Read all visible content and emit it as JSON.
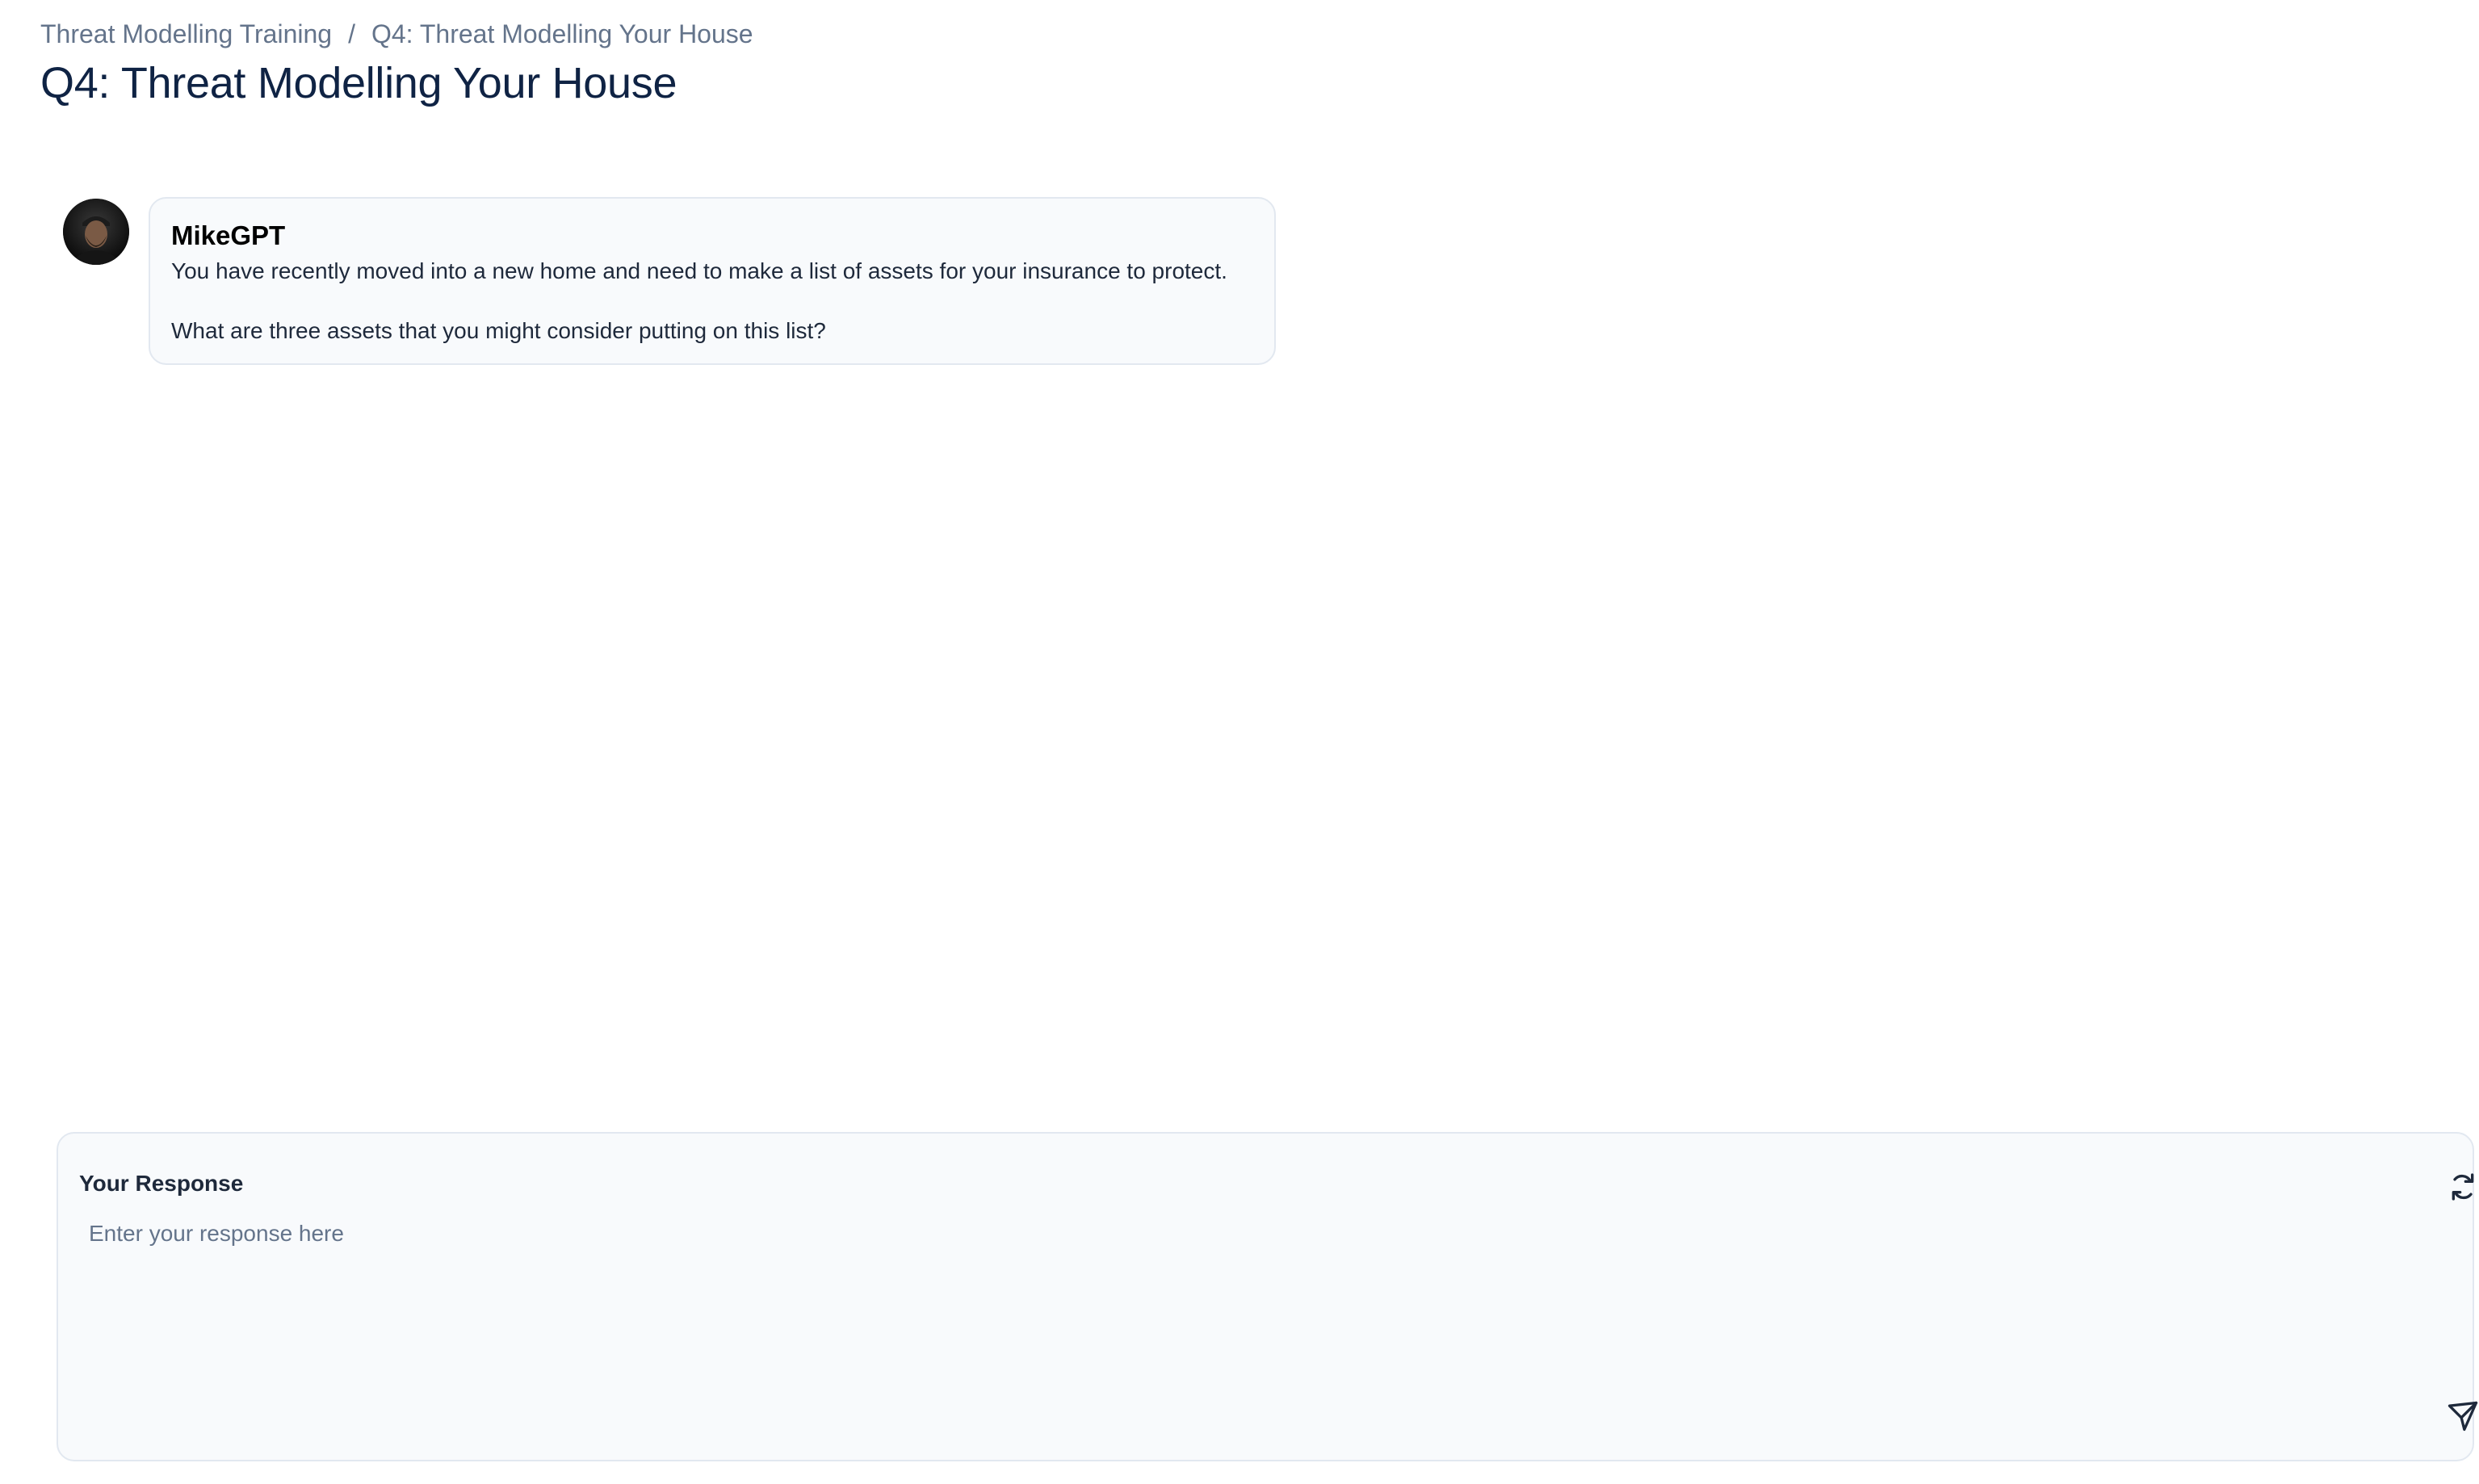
{
  "breadcrumb": {
    "parent": "Threat Modelling Training",
    "separator": "/",
    "current": "Q4: Threat Modelling Your House"
  },
  "page": {
    "title": "Q4: Threat Modelling Your House"
  },
  "message": {
    "sender": "MikeGPT",
    "avatar_icon": "user-avatar",
    "lines": [
      "You have recently moved into a new home and need to make a list of assets for your insurance to protect.",
      "What are three assets that you might consider putting on this list?"
    ]
  },
  "response": {
    "label": "Your Response",
    "placeholder": "Enter your response here",
    "value": "",
    "refresh_icon": "refresh-icon",
    "send_icon": "send-icon"
  },
  "colors": {
    "title": "#0f2344",
    "muted": "#64748b",
    "panel_bg": "#f8fafc",
    "border": "#e2e8f0"
  }
}
